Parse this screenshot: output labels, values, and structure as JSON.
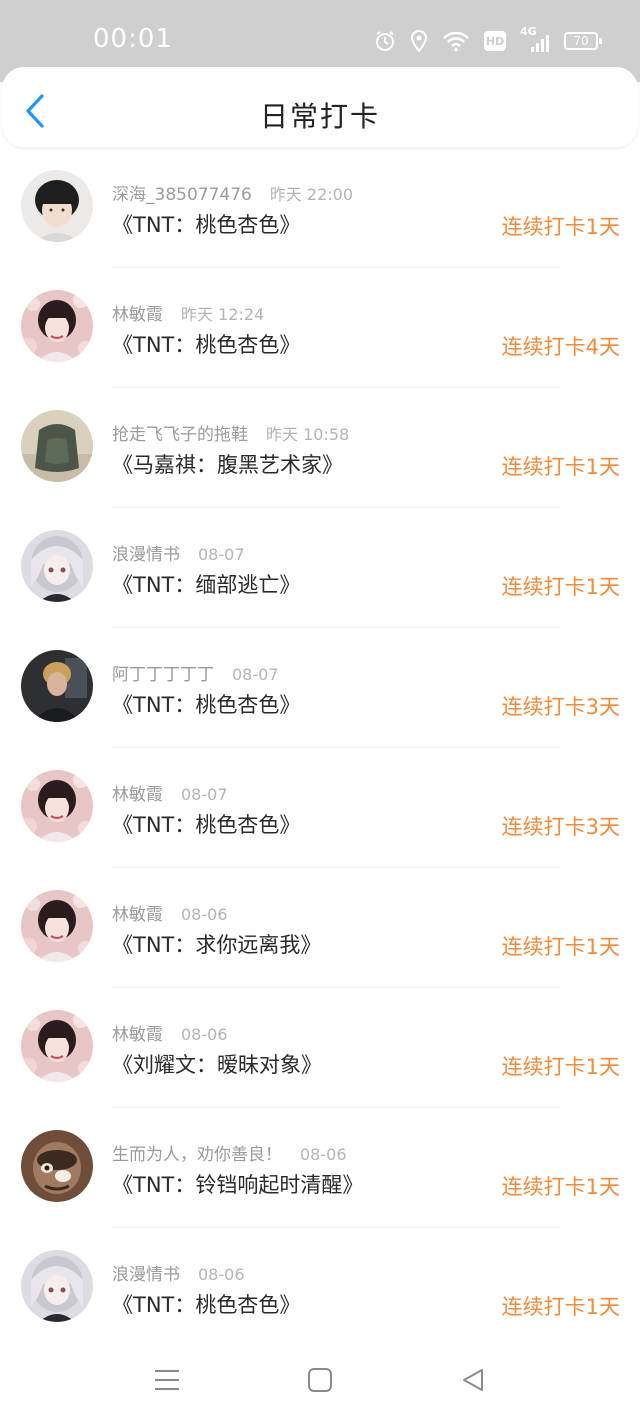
{
  "status": {
    "time": "00:01",
    "network": "4G",
    "hd": "HD",
    "battery": "70"
  },
  "header": {
    "title": "日常打卡"
  },
  "checkins": [
    {
      "user": "深海_385077476",
      "time": "昨天 22:00",
      "book": "《TNT：桃色杏色》",
      "streak": "连续打卡1天",
      "avatar": "a1"
    },
    {
      "user": "林敏霞",
      "time": "昨天 12:24",
      "book": "《TNT：桃色杏色》",
      "streak": "连续打卡4天",
      "avatar": "a2"
    },
    {
      "user": "抢走飞飞子的拖鞋",
      "time": "昨天 10:58",
      "book": "《马嘉祺：腹黑艺术家》",
      "streak": "连续打卡1天",
      "avatar": "a3"
    },
    {
      "user": "浪漫情书",
      "time": "08-07",
      "book": "《TNT：缅部逃亡》",
      "streak": "连续打卡1天",
      "avatar": "a4"
    },
    {
      "user": "阿丁丁丁丁丁",
      "time": "08-07",
      "book": "《TNT：桃色杏色》",
      "streak": "连续打卡3天",
      "avatar": "a5"
    },
    {
      "user": "林敏霞",
      "time": "08-07",
      "book": "《TNT：桃色杏色》",
      "streak": "连续打卡3天",
      "avatar": "a2"
    },
    {
      "user": "林敏霞",
      "time": "08-06",
      "book": "《TNT：求你远离我》",
      "streak": "连续打卡1天",
      "avatar": "a2"
    },
    {
      "user": "林敏霞",
      "time": "08-06",
      "book": "《刘耀文：暧昧对象》",
      "streak": "连续打卡1天",
      "avatar": "a2"
    },
    {
      "user": "生而为人，劝你善良！",
      "time": "08-06",
      "book": "《TNT：铃铛响起时清醒》",
      "streak": "连续打卡1天",
      "avatar": "a6"
    },
    {
      "user": "浪漫情书",
      "time": "08-06",
      "book": "《TNT：桃色杏色》",
      "streak": "连续打卡1天",
      "avatar": "a4"
    }
  ],
  "colors": {
    "accent": "#2196f3",
    "streak": "#f08a3c",
    "status_bar": "#cfcfcf"
  },
  "icons": {
    "back": "chevron-left-icon",
    "menu": "menu-icon",
    "home": "home-square-icon",
    "back_nav": "back-triangle-icon"
  }
}
